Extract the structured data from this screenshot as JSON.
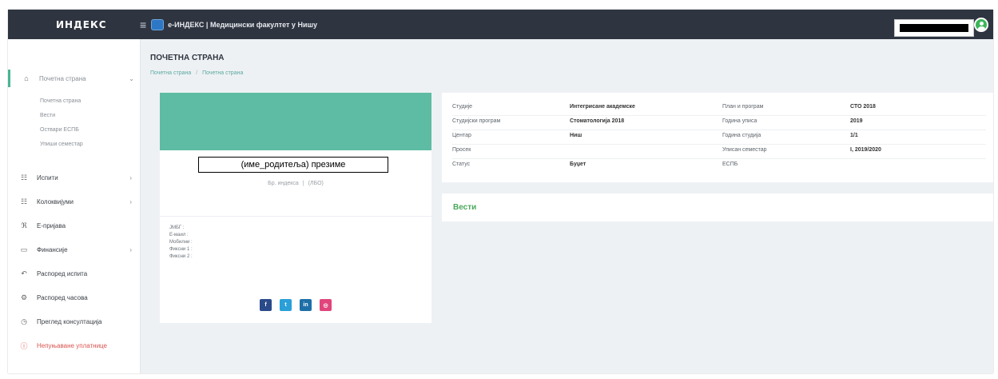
{
  "header": {
    "logo": "ИНДЕКС",
    "hamburger": "≡",
    "app_title": "е-ИНДЕКС | Медицински факултет у Нишу"
  },
  "sidebar": {
    "main": {
      "label": "Почетна страна",
      "icon": "home-icon",
      "glyph": "⌂",
      "caret": "⌄"
    },
    "sub_items": [
      "Почетна страна",
      "Вести",
      "Оствари ЕСПБ",
      "Упиши семестар"
    ],
    "items": [
      {
        "label": "Испити",
        "icon": "list-icon",
        "glyph": "☷",
        "caret": "›"
      },
      {
        "label": "Колоквијуми",
        "icon": "list-icon",
        "glyph": "☷",
        "caret": "›"
      },
      {
        "label": "Е-пријава",
        "icon": "rss-icon",
        "glyph": "ℜ",
        "caret": ""
      },
      {
        "label": "Финансије",
        "icon": "wallet-icon",
        "glyph": "▭",
        "caret": "›"
      },
      {
        "label": "Распоред испита",
        "icon": "undo-icon",
        "glyph": "↶",
        "caret": ""
      },
      {
        "label": "Распоред часова",
        "icon": "gear-icon",
        "glyph": "⚙",
        "caret": ""
      },
      {
        "label": "Преглед консултација",
        "icon": "clock-icon",
        "glyph": "◷",
        "caret": ""
      },
      {
        "label": "Непуњаване уплатнице",
        "icon": "alert-icon",
        "glyph": "ⓘ",
        "caret": ""
      }
    ]
  },
  "main": {
    "page_title": "ПОЧЕТНА СТРАНА",
    "breadcrumb": [
      "Почетна страна",
      "Почетна страна"
    ],
    "breadcrumb_sep": "/"
  },
  "profile": {
    "name": "(име_родитеља) презиме",
    "index_label": "Бр. индекса",
    "index_sep": "|",
    "index_value": "(ЛБО)",
    "info": [
      "ЈМБГ :",
      "Е-маил :",
      "Мобилни :",
      "Фиксни 1 :",
      "Фиксни 2 :"
    ],
    "socials": [
      {
        "name": "facebook-icon",
        "glyph": "f",
        "color": "#2a4a8a"
      },
      {
        "name": "twitter-icon",
        "glyph": "t",
        "color": "#2a9fd8"
      },
      {
        "name": "linkedin-icon",
        "glyph": "in",
        "color": "#1e6fa8"
      },
      {
        "name": "instagram-icon",
        "glyph": "◎",
        "color": "#e0457b"
      }
    ]
  },
  "student_info": {
    "rows": [
      [
        "Студије",
        "Интегрисане академске",
        "План и програм",
        "СТО 2018"
      ],
      [
        "Студијски програм",
        "Стоматологија 2018",
        "Година уписа",
        "2019"
      ],
      [
        "Центар",
        "Ниш",
        "Година студија",
        "1/1"
      ],
      [
        "Просек",
        "",
        "Уписан семестар",
        "I, 2019/2020"
      ],
      [
        "Статус",
        "Буџет",
        "ЕСПБ",
        ""
      ]
    ]
  },
  "news": {
    "title": "Вести"
  },
  "colors": {
    "topbar": "#2f3540",
    "banner": "#5dbca3",
    "accent_green": "#4ab493",
    "news_title": "#4aa85c",
    "alert": "#d9534f"
  }
}
